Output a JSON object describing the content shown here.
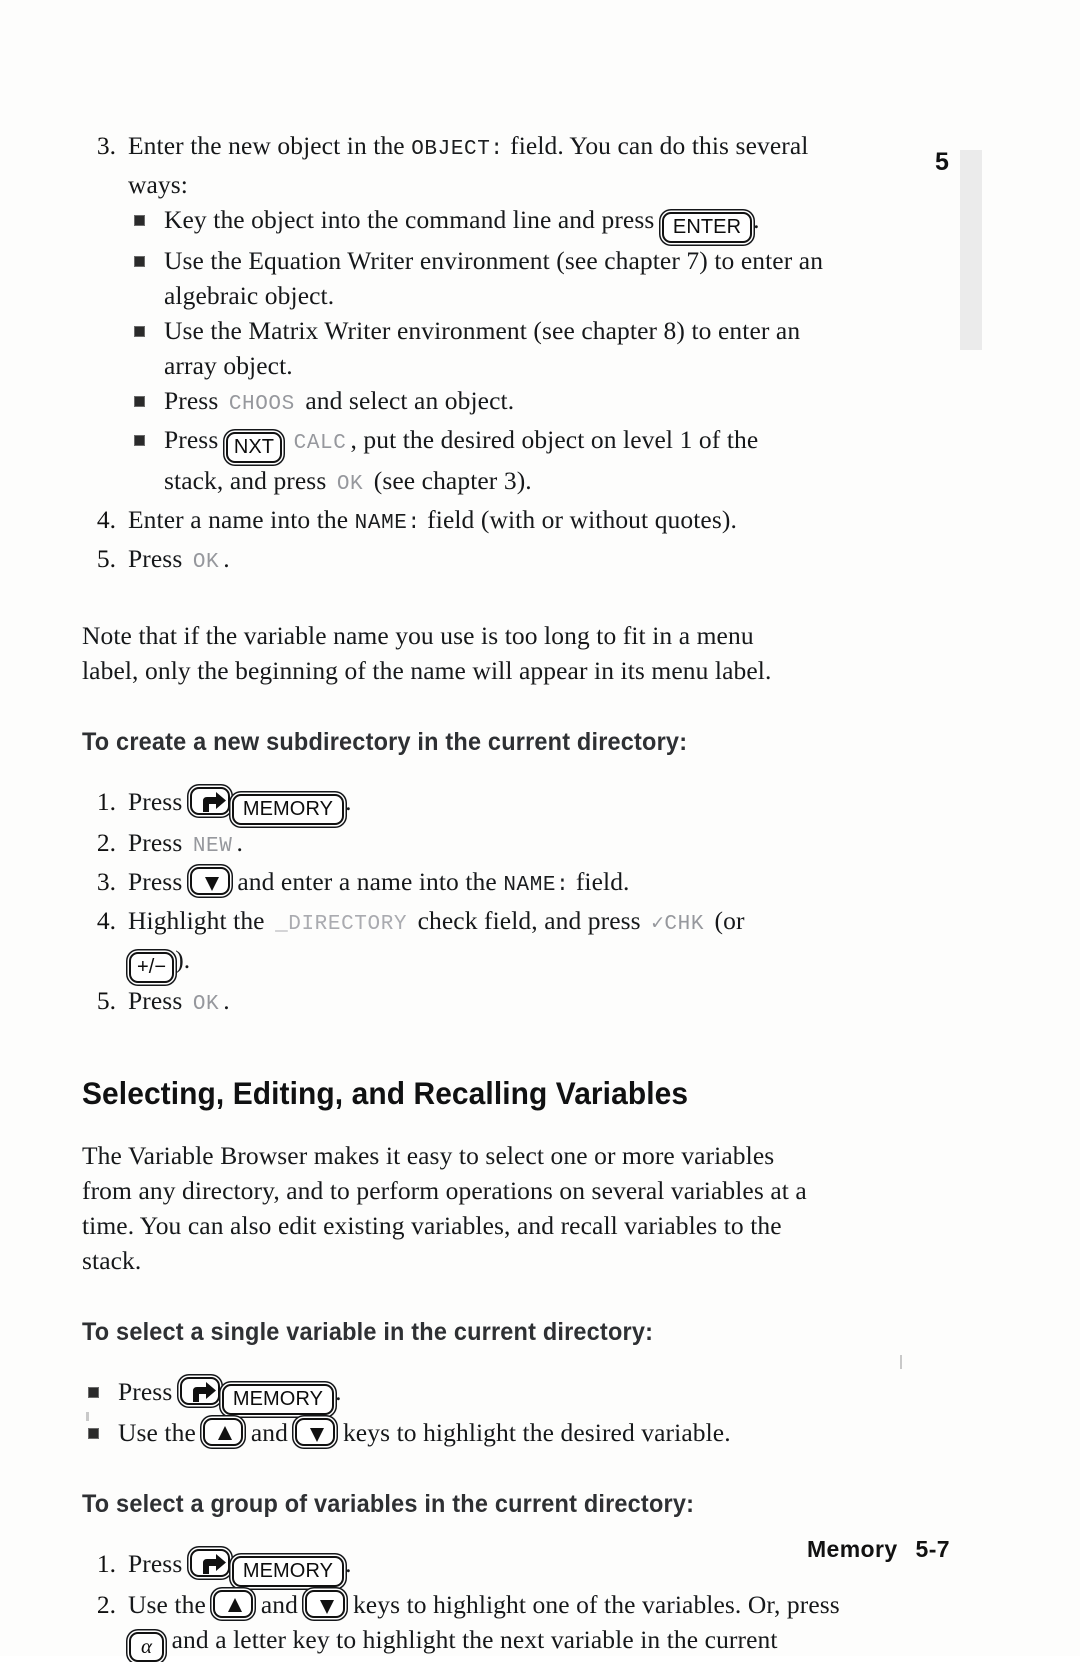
{
  "chapter_tab": "5",
  "footer": {
    "section": "Memory",
    "page": "5-7"
  },
  "step3": {
    "num": "3.",
    "text_before": "Enter the new object in the",
    "field": "OBJECT:",
    "text_after": "field. You can do this several",
    "line2": "ways:",
    "bullets": [
      {
        "before": "Key the object into the command line and press",
        "key": "ENTER",
        "after": "."
      },
      {
        "before": "Use the Equation Writer environment (see chapter 7) to enter an",
        "line2": "algebraic object."
      },
      {
        "before": "Use the Matrix Writer environment (see chapter 8) to enter an",
        "line2": "array object."
      },
      {
        "before": "Press",
        "softkey": "CHOOS",
        "after": "and select an object."
      },
      {
        "before": "Press",
        "key": "NXT",
        "softkey": "CALC",
        "after": ", put the desired object on level 1 of the",
        "line2_before": "stack, and press",
        "line2_softkey": "OK",
        "line2_after": "(see chapter 3)."
      }
    ]
  },
  "step4": {
    "num": "4.",
    "text_before": "Enter a name into the",
    "field": "NAME:",
    "text_after": "field (with or without quotes)."
  },
  "step5": {
    "num": "5.",
    "text_before": "Press",
    "softkey": "OK",
    "text_after": "."
  },
  "note": {
    "line1": "Note that if the variable name you use is too long to fit in a menu",
    "line2": "label, only the beginning of the name will appear in its menu label."
  },
  "subdir": {
    "heading": "To create a new subdirectory in the current directory:",
    "steps": [
      {
        "num": "1.",
        "before": "Press",
        "key_shift": "right-shift",
        "key": "MEMORY",
        "after": "."
      },
      {
        "num": "2.",
        "before": "Press",
        "softkey": "NEW",
        "after": "."
      },
      {
        "num": "3.",
        "before": "Press",
        "key_arrow": "down-arrow",
        "mid": "and enter a name into the",
        "field": "NAME:",
        "after": "field."
      },
      {
        "num": "4.",
        "before": "Highlight the",
        "field": "_DIRECTORY",
        "mid": "check field, and press",
        "softkey": "✓CHK",
        "after": "(or",
        "line2_key": "+/−",
        "line2_after": ")."
      },
      {
        "num": "5.",
        "before": "Press",
        "softkey": "OK",
        "after": "."
      }
    ]
  },
  "section": {
    "title": "Selecting, Editing, and Recalling Variables",
    "intro_lines": [
      "The Variable Browser makes it easy to select one or more variables",
      "from any directory, and to perform operations on several variables at a",
      "time.  You can also edit existing variables, and recall variables to the",
      "stack."
    ]
  },
  "select_single": {
    "heading": "To select a single variable in the current directory:",
    "bullets": [
      {
        "before": "Press",
        "key_shift": "right-shift",
        "key": "MEMORY",
        "after": "."
      },
      {
        "before": "Use the",
        "key_up": "up-arrow",
        "mid": "and",
        "key_down": "down-arrow",
        "after": "keys to highlight the desired variable."
      }
    ]
  },
  "select_group": {
    "heading": "To select a group of variables in the current directory:",
    "steps": [
      {
        "num": "1.",
        "before": "Press",
        "key_shift": "right-shift",
        "key": "MEMORY",
        "after": "."
      },
      {
        "num": "2.",
        "before": "Use the",
        "key_up": "up-arrow",
        "mid": "and",
        "key_down": "down-arrow",
        "after": "keys to highlight one of the variables.  Or, press",
        "line2_key": "α",
        "line2_after": "and a letter key to highlight the next variable in the current"
      }
    ]
  }
}
